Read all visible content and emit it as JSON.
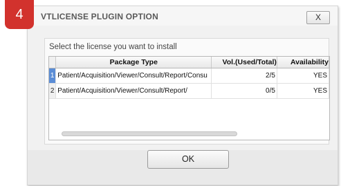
{
  "step": {
    "number": "4"
  },
  "dialog": {
    "title": "VTLICENSE PLUGIN OPTION",
    "close_label": "X",
    "instruction": "Select the license you want to install"
  },
  "table": {
    "columns": [
      "Package Type",
      "Vol.(Used/Total)",
      "Availability"
    ],
    "rows": [
      {
        "index": "1",
        "package_type": "Patient/Acquisition/Viewer/Consult/Report/Consu",
        "volume": "2/5",
        "availability": "YES",
        "selected": true
      },
      {
        "index": "2",
        "package_type": "Patient/Acquisition/Viewer/Consult/Report/",
        "volume": "0/5",
        "availability": "YES",
        "selected": false
      }
    ]
  },
  "footer": {
    "ok_label": "OK"
  }
}
